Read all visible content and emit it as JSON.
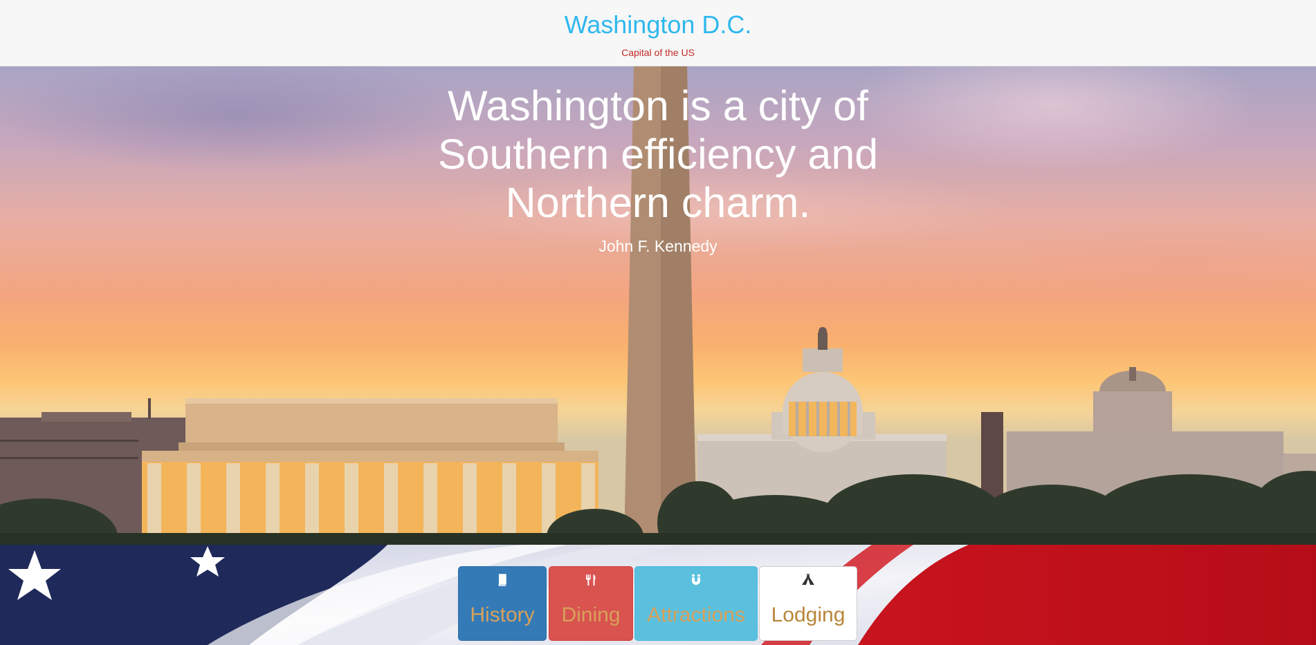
{
  "header": {
    "title": "Washington D.C.",
    "subtitle": "Capital of the US"
  },
  "hero": {
    "quote": "Washington is a city of Southern efficiency and Northern charm.",
    "author": "John F. Kennedy"
  },
  "nav_cards": [
    {
      "label": "History",
      "icon": "book-icon",
      "color": "#337ab7"
    },
    {
      "label": "Dining",
      "icon": "cutlery-icon",
      "color": "#d9534f"
    },
    {
      "label": "Attractions",
      "icon": "magnet-icon",
      "color": "#5bc0de"
    },
    {
      "label": "Lodging",
      "icon": "tent-icon",
      "color": "#ffffff"
    }
  ],
  "colors": {
    "title": "#2fb8ee",
    "subtitle": "#c62828",
    "card_label": "#d7a15a"
  }
}
